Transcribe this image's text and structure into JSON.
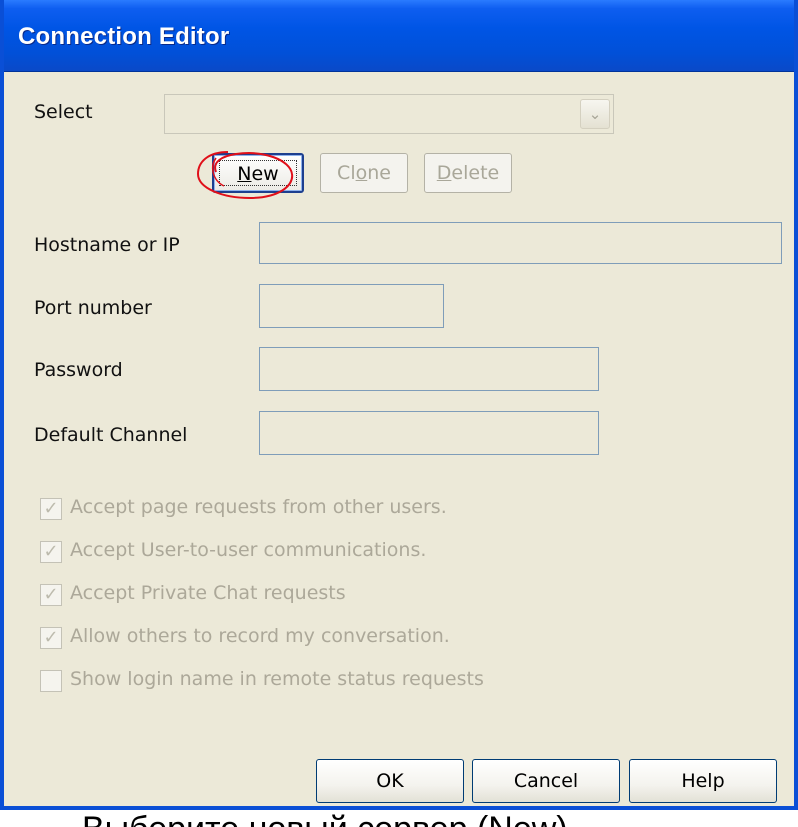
{
  "window": {
    "title": "Connection Editor"
  },
  "select": {
    "label": "Select",
    "value": "",
    "arrow_icon": "chevron-down-icon"
  },
  "buttons_top": {
    "new": {
      "label": "New",
      "accel": "N",
      "rest": "ew"
    },
    "clone": {
      "label": "Clone",
      "pre": "Cl",
      "accel": "o",
      "rest": "ne"
    },
    "delete": {
      "label": "Delete",
      "accel": "D",
      "rest": "elete"
    }
  },
  "fields": {
    "hostname": {
      "label": "Hostname or IP",
      "value": ""
    },
    "port": {
      "label": "Port number",
      "value": ""
    },
    "password": {
      "label": "Password",
      "value": ""
    },
    "channel": {
      "label": "Default Channel",
      "value": ""
    }
  },
  "checkboxes": [
    {
      "label": "Accept page requests from other users.",
      "checked": true
    },
    {
      "label": "Accept User-to-user communications.",
      "checked": true
    },
    {
      "label": "Accept Private Chat requests",
      "checked": true
    },
    {
      "label": "Allow others to record my conversation.",
      "checked": true
    },
    {
      "label": "Show login name in remote status requests",
      "checked": false
    }
  ],
  "buttons_bottom": {
    "ok": "OK",
    "cancel": "Cancel",
    "help": "Help"
  },
  "caption": "Выберите новый сервер (New)",
  "colors": {
    "titlebar": "#0055e5",
    "dialog_bg": "#ece9d8",
    "annotation": "#e0101a"
  }
}
